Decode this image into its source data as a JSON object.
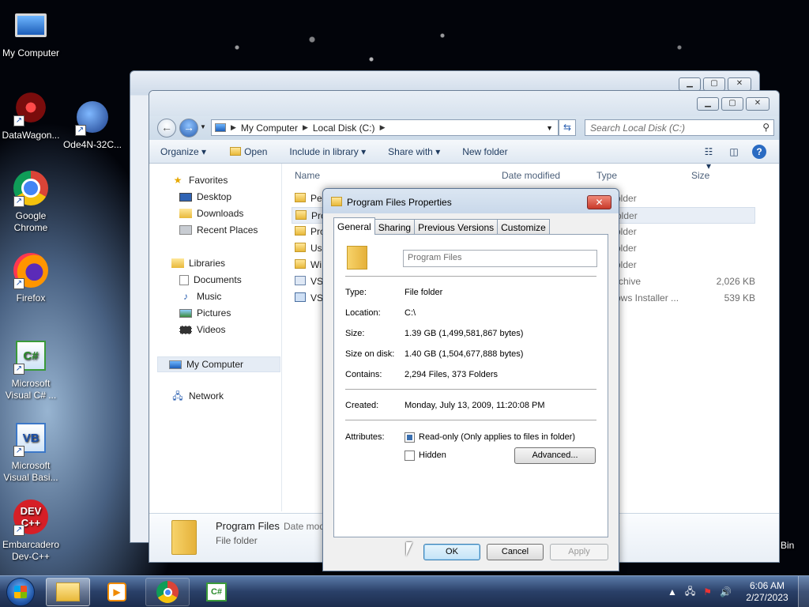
{
  "desktop": {
    "icons": [
      {
        "label": "My Computer",
        "icon": "computer-icon"
      },
      {
        "label": "DataWagon...",
        "icon": "datawagon-icon"
      },
      {
        "label": "Ode4N-32C...",
        "icon": "ode-icon"
      },
      {
        "label": "Google Chrome",
        "icon": "chrome-icon"
      },
      {
        "label": "Firefox",
        "icon": "firefox-icon"
      },
      {
        "label": "Microsoft Visual C# ...",
        "icon": "csharp-icon"
      },
      {
        "label": "Microsoft Visual Basi...",
        "icon": "vb-icon"
      },
      {
        "label": "Embarcadero Dev-C++",
        "icon": "devcpp-icon"
      }
    ],
    "recycle_partial_label": "Bin",
    "dev_icon_text": "DEV C++",
    "cs_icon_text": "C#",
    "vb_icon_text": "VB"
  },
  "explorer": {
    "address": {
      "crumbs": [
        "My Computer",
        "Local Disk (C:)"
      ]
    },
    "search_placeholder": "Search Local Disk (C:)",
    "toolbar": {
      "organize": "Organize",
      "open": "Open",
      "include_in_library": "Include in library",
      "share_with": "Share with",
      "new_folder": "New folder"
    },
    "nav": {
      "favorites": "Favorites",
      "desktop": "Desktop",
      "downloads": "Downloads",
      "recent_places": "Recent Places",
      "libraries": "Libraries",
      "documents": "Documents",
      "music": "Music",
      "pictures": "Pictures",
      "videos": "Videos",
      "my_computer": "My Computer",
      "network": "Network"
    },
    "columns": {
      "name": "Name",
      "date_modified": "Date modified",
      "type": "Type",
      "size": "Size"
    },
    "files": [
      {
        "name": "Pe",
        "type": "older",
        "size": ""
      },
      {
        "name": "Pro",
        "type": "older",
        "size": ""
      },
      {
        "name": "Pro",
        "type": "older",
        "size": ""
      },
      {
        "name": "Us",
        "type": "older",
        "size": ""
      },
      {
        "name": "Wi",
        "type": "older",
        "size": ""
      },
      {
        "name": "VS",
        "type": "rchive",
        "size": "2,026 KB"
      },
      {
        "name": "VS",
        "type": "ows Installer ...",
        "size": "539 KB"
      }
    ],
    "details": {
      "name": "Program Files",
      "date_modified_partial": "Date mod",
      "type": "File folder"
    }
  },
  "dialog": {
    "title": "Program Files Properties",
    "close_glyph": "✕",
    "tabs": [
      "General",
      "Sharing",
      "Previous Versions",
      "Customize"
    ],
    "name_value": "Program Files",
    "props": {
      "type_label": "Type:",
      "type_value": "File folder",
      "location_label": "Location:",
      "location_value": "C:\\",
      "size_label": "Size:",
      "size_value": "1.39 GB (1,499,581,867 bytes)",
      "size_on_disk_label": "Size on disk:",
      "size_on_disk_value": "1.40 GB (1,504,677,888 bytes)",
      "contains_label": "Contains:",
      "contains_value": "2,294 Files, 373 Folders",
      "created_label": "Created:",
      "created_value": "Monday, July 13, 2009, 11:20:08 PM",
      "attributes_label": "Attributes:"
    },
    "attributes": {
      "readonly_label": "Read-only (Only applies to files in folder)",
      "hidden_label": "Hidden",
      "advanced_button": "Advanced..."
    },
    "buttons": {
      "ok": "OK",
      "cancel": "Cancel",
      "apply": "Apply"
    }
  },
  "taskbar": {
    "clock_time": "6:06 AM",
    "clock_date": "2/27/2023",
    "cs_label": "C#"
  }
}
